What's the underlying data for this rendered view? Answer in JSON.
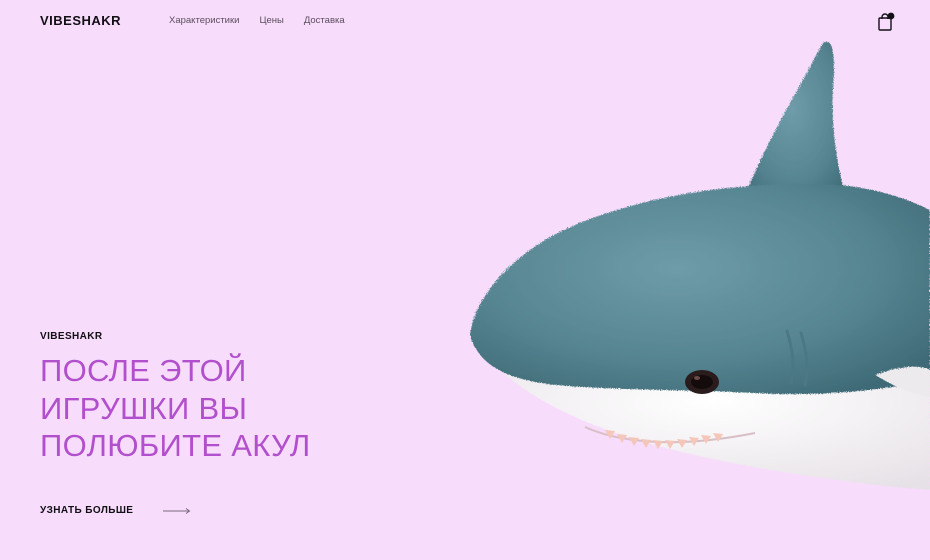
{
  "header": {
    "logo": "VIBESHAKR",
    "nav": [
      "Характеристики",
      "Цены",
      "Доставка"
    ]
  },
  "hero": {
    "eyebrow": "VIBESHAKR",
    "title_lines": [
      "ПОСЛЕ ЭТОЙ",
      "ИГРУШКИ ВЫ",
      "ПОЛЮБИТЕ АКУЛ"
    ],
    "cta_label": "УЗНАТЬ БОЛЬШЕ"
  },
  "icons": {
    "cart": "shopping-bag-icon",
    "cta_arrow": "long-arrow-right-icon"
  },
  "colors": {
    "background": "#f7dcfb",
    "accent": "#b24fcc",
    "text": "#121014",
    "shark_body": "#5a8a96",
    "shark_belly": "#f5f2f4"
  }
}
